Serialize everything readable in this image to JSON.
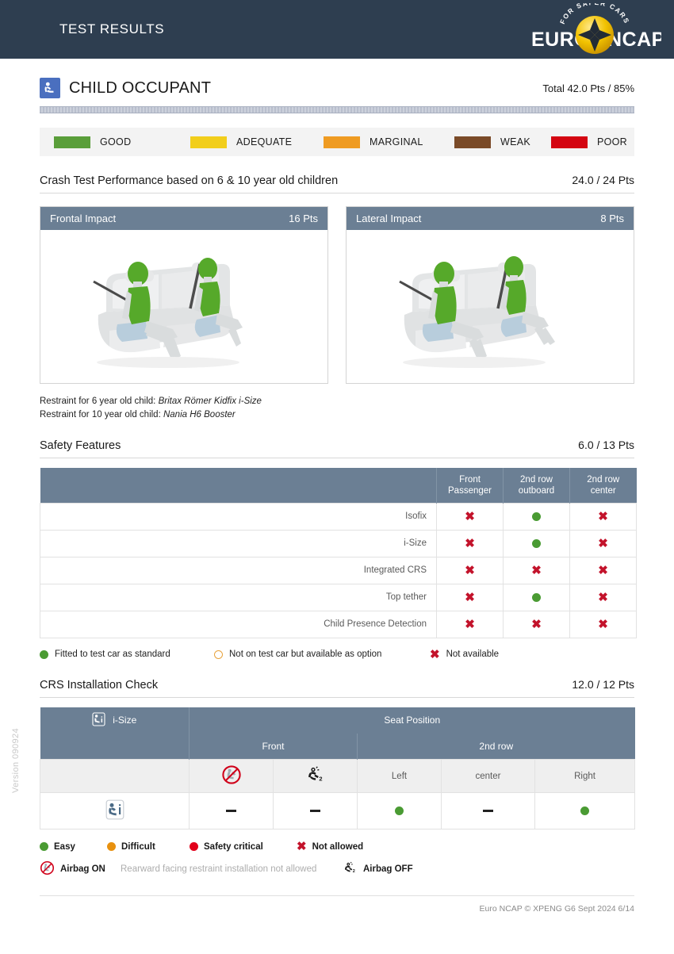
{
  "header": {
    "title": "TEST RESULTS",
    "logo_text_left": "EURO",
    "logo_text_right": "NCAP",
    "logo_arc_text": "FOR SAFER CARS"
  },
  "category": {
    "icon": "child-seat-icon",
    "name": "CHILD OCCUPANT",
    "total": "Total 42.0 Pts / 85%",
    "score_percent": 85
  },
  "rating_legend": [
    {
      "label": "GOOD",
      "color": "#5a9e3a"
    },
    {
      "label": "ADEQUATE",
      "color": "#f2ce1b"
    },
    {
      "label": "MARGINAL",
      "color": "#ef9b22"
    },
    {
      "label": "WEAK",
      "color": "#7a4a28"
    },
    {
      "label": "POOR",
      "color": "#d40511"
    }
  ],
  "crash_test": {
    "title": "Crash Test Performance based on 6 & 10 year old children",
    "points": "24.0 / 24 Pts",
    "panels": [
      {
        "label": "Frontal Impact",
        "points": "16 Pts"
      },
      {
        "label": "Lateral Impact",
        "points": "8 Pts"
      }
    ],
    "restraint_6_label": "Restraint for 6 year old child:",
    "restraint_6_value": "Britax Römer Kidfix i-Size",
    "restraint_10_label": "Restraint for 10 year old child:",
    "restraint_10_value": "Nania H6 Booster"
  },
  "safety_features": {
    "title": "Safety Features",
    "points": "6.0 / 13 Pts",
    "columns": [
      "",
      "Front Passenger",
      "2nd row outboard",
      "2nd row center"
    ],
    "columns_split": [
      {
        "line1": "Front",
        "line2": "Passenger"
      },
      {
        "line1": "2nd row",
        "line2": "outboard"
      },
      {
        "line1": "2nd row",
        "line2": "center"
      }
    ],
    "rows": [
      {
        "label": "Isofix",
        "values": [
          "cross",
          "green",
          "cross"
        ]
      },
      {
        "label": "i-Size",
        "values": [
          "cross",
          "green",
          "cross"
        ]
      },
      {
        "label": "Integrated CRS",
        "values": [
          "cross",
          "cross",
          "cross"
        ]
      },
      {
        "label": "Top tether",
        "values": [
          "cross",
          "green",
          "cross"
        ]
      },
      {
        "label": "Child Presence Detection",
        "values": [
          "cross",
          "cross",
          "cross"
        ]
      }
    ],
    "availability_legend": [
      {
        "marker": "green",
        "label": "Fitted to test car as standard"
      },
      {
        "marker": "orange-outline",
        "label": "Not on test car but available as option"
      },
      {
        "marker": "cross",
        "label": "Not available"
      }
    ]
  },
  "crs_installation": {
    "title": "CRS Installation Check",
    "points": "12.0 / 12 Pts",
    "corner_label": "i-Size",
    "corner_icon": "i-size-seat-icon",
    "seat_position_header": "Seat Position",
    "group_front": "Front",
    "group_second_row": "2nd row",
    "sub_headers": [
      {
        "type": "icon",
        "icon": "airbag-on-icon",
        "label": ""
      },
      {
        "type": "icon",
        "icon": "airbag-off-icon",
        "label": ""
      },
      {
        "type": "text",
        "label": "Left"
      },
      {
        "type": "text",
        "label": "center"
      },
      {
        "type": "text",
        "label": "Right"
      }
    ],
    "data_row": {
      "row_icon": "child-seat-i-icon",
      "values": [
        "dash",
        "dash",
        "green",
        "dash",
        "green"
      ]
    },
    "legend_row1": [
      {
        "marker": "green",
        "label": "Easy"
      },
      {
        "marker": "orange",
        "label": "Difficult"
      },
      {
        "marker": "red",
        "label": "Safety critical"
      },
      {
        "marker": "cross",
        "label": "Not allowed"
      }
    ],
    "legend_row2": [
      {
        "marker": "airbag-on-icon",
        "label": "Airbag ON",
        "bold": true
      },
      {
        "marker": "none",
        "label": "Rearward facing restraint installation not allowed",
        "muted": true
      },
      {
        "marker": "airbag-off-icon",
        "label": "Airbag OFF",
        "bold": true
      }
    ]
  },
  "footer": {
    "text": "Euro NCAP © XPENG G6 Sept 2024 6/14",
    "version": "Version 090924"
  }
}
